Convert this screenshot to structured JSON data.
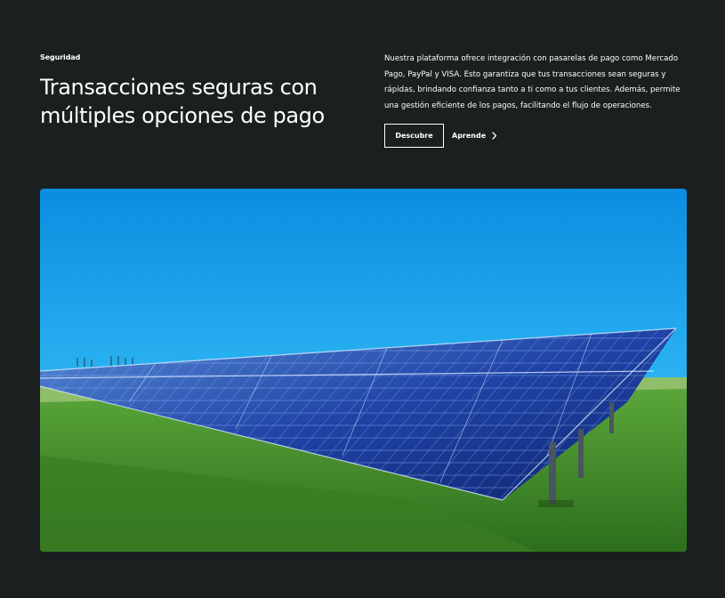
{
  "section": {
    "tagline": "Seguridad",
    "title_line1": "Transacciones seguras con",
    "title_line2": "múltiples opciones de pago",
    "description": "Nuestra plataforma ofrece integración con pasarelas de pago como Mercado Pago, PayPal y VISA. Esto garantiza que tus transacciones sean seguras y rápidas, brindando confianza tanto a ti como a tus clientes. Además, permite una gestión eficiente de los pagos, facilitando el flujo de operaciones."
  },
  "actions": {
    "primary_label": "Descubre",
    "secondary_label": "Aprende",
    "secondary_icon": "chevron-right-icon"
  },
  "hero_image": {
    "subject": "solar-panels-field"
  },
  "colors": {
    "background": "#1b1f1f",
    "text": "#ffffff",
    "sky_top": "#0a8de0",
    "sky_bottom": "#48d6ff",
    "grass": "#3f8f2a",
    "panel": "#1e3f9c"
  }
}
